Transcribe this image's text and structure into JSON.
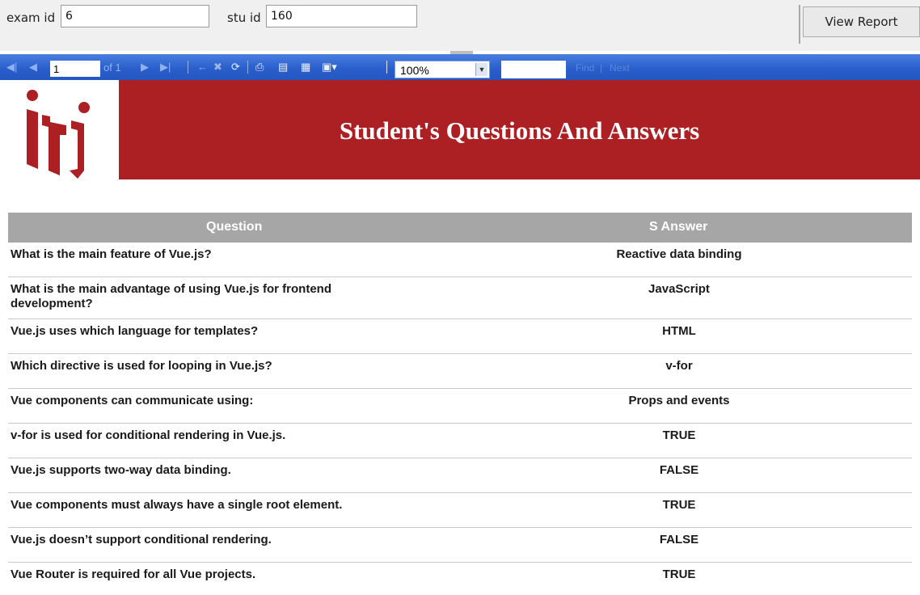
{
  "params": {
    "exam_label": "exam id",
    "exam_value": "6",
    "stu_label": "stu id",
    "stu_value": "160",
    "view_button": "View Report"
  },
  "toolbar": {
    "page_value": "1",
    "of_pages": "of 1",
    "zoom": "100%",
    "find_label": "Find",
    "find_sep": "|",
    "next_label": "Next",
    "icons": [
      "first-page",
      "previous-page",
      "next-page",
      "last-page",
      "back",
      "stop",
      "refresh",
      "print",
      "print-layout",
      "page-setup",
      "export"
    ]
  },
  "report": {
    "title": "Student's Questions And Answers",
    "columns": {
      "question": "Question",
      "answer": "S Answer"
    },
    "rows": [
      {
        "q": "What is the main feature of Vue.js?",
        "a": "Reactive data binding"
      },
      {
        "q": "What is the main advantage of using Vue.js for frontend development?",
        "a": "JavaScript"
      },
      {
        "q": "Vue.js uses which language for templates?",
        "a": "HTML"
      },
      {
        "q": "Which directive is used for looping in Vue.js?",
        "a": "v-for"
      },
      {
        "q": "Vue components can communicate using:",
        "a": "Props and events"
      },
      {
        "q": "v-for is used for conditional rendering in Vue.js.",
        "a": "TRUE"
      },
      {
        "q": "Vue.js supports two-way data binding.",
        "a": "FALSE"
      },
      {
        "q": "Vue components must always have a single root element.",
        "a": "TRUE"
      },
      {
        "q": "Vue.js doesn’t support conditional rendering.",
        "a": "FALSE"
      },
      {
        "q": "Vue Router is required for all Vue projects.",
        "a": "TRUE"
      }
    ]
  },
  "colors": {
    "banner": "#ac1f22",
    "table_header": "#a6a6a6",
    "toolbar": "#2a5fcc"
  }
}
